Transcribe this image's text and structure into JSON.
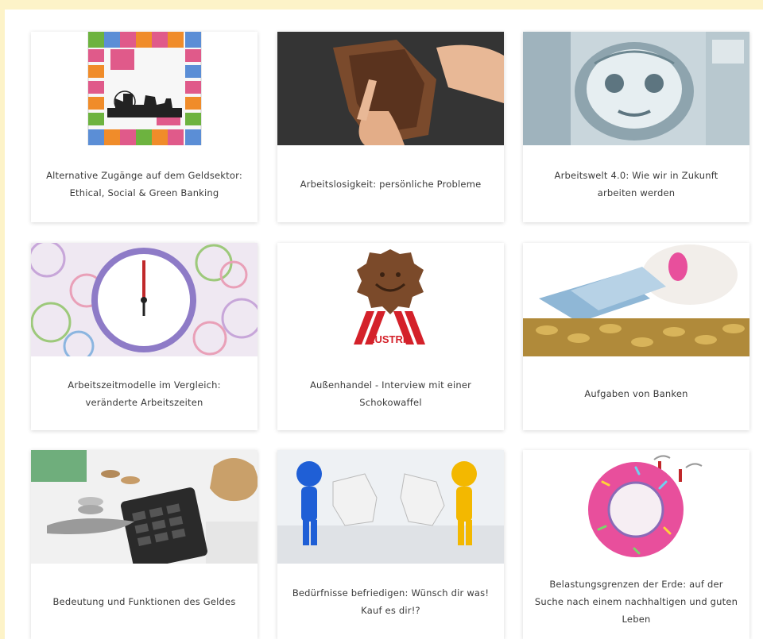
{
  "cards": [
    {
      "title": "Alternative Zugänge auf dem Geldsektor: Ethical, Social & Green Banking",
      "image_alt": "monopoly-board-image"
    },
    {
      "title": "Arbeitslosigkeit: persönliche Probleme",
      "image_alt": "empty-wallet-image"
    },
    {
      "title": "Arbeitswelt 4.0: Wie wir in Zukunft arbeiten werden",
      "image_alt": "robot-face-image"
    },
    {
      "title": "Arbeitszeitmodelle im Vergleich: veränderte Arbeitszeiten",
      "image_alt": "clocks-image"
    },
    {
      "title": "Außenhandel - Interview mit einer Schokowaffel",
      "image_alt": "austria-waffle-image",
      "badge_text": "AUSTRIA"
    },
    {
      "title": "Aufgaben von Banken",
      "image_alt": "piggy-bank-image"
    },
    {
      "title": "Bedeutung und Funktionen des Geldes",
      "image_alt": "coins-calculator-image"
    },
    {
      "title": "Bedürfnisse befriedigen: Wünsch dir was! Kauf es dir!?",
      "image_alt": "puzzle-figures-image"
    },
    {
      "title": "Belastungsgrenzen der Erde: auf der Suche nach einem nachhaltigen und guten Leben",
      "image_alt": "donut-earth-image"
    }
  ],
  "colors": {
    "page_background": "#fdf3c8",
    "card_background": "#ffffff",
    "caption_text": "#3a3a3a",
    "austria_red": "#d4212a",
    "donut_pink": "#e84f9c"
  }
}
